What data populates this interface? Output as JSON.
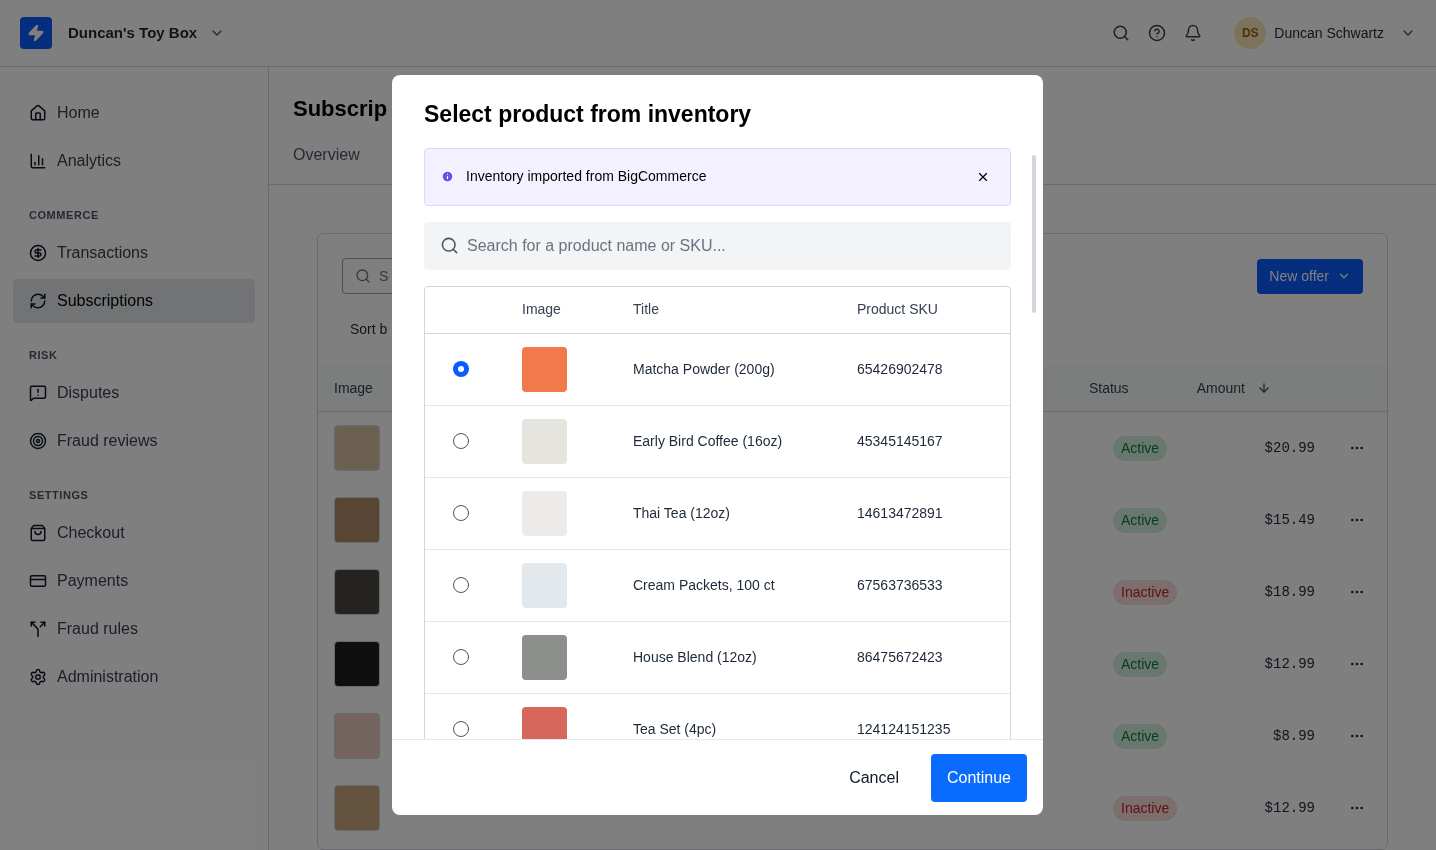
{
  "header": {
    "store_name": "Duncan's Toy Box",
    "user_initials": "DS",
    "user_name": "Duncan Schwartz"
  },
  "sidebar": {
    "sections": [
      {
        "items": [
          {
            "label": "Home",
            "selected": false
          },
          {
            "label": "Analytics",
            "selected": false
          }
        ]
      },
      {
        "label": "COMMERCE",
        "items": [
          {
            "label": "Transactions",
            "selected": false
          },
          {
            "label": "Subscriptions",
            "selected": true
          }
        ]
      },
      {
        "label": "RISK",
        "items": [
          {
            "label": "Disputes",
            "selected": false
          },
          {
            "label": "Fraud reviews",
            "selected": false
          }
        ]
      },
      {
        "label": "SETTINGS",
        "items": [
          {
            "label": "Checkout",
            "selected": false
          },
          {
            "label": "Payments",
            "selected": false
          },
          {
            "label": "Fraud rules",
            "selected": false
          },
          {
            "label": "Administration",
            "selected": false
          }
        ]
      }
    ]
  },
  "page": {
    "title": "Subscrip",
    "tab": "Overview",
    "search_placeholder": "S",
    "sort_label": "Sort b",
    "new_offer_button": "New offer",
    "columns": [
      "Image",
      "Status",
      "Amount"
    ],
    "rows": [
      {
        "status": "Active",
        "kind": "active",
        "amount": "$20.99"
      },
      {
        "status": "Active",
        "kind": "active",
        "amount": "$15.49"
      },
      {
        "status": "Inactive",
        "kind": "inactive",
        "amount": "$18.99"
      },
      {
        "status": "Active",
        "kind": "active",
        "amount": "$12.99"
      },
      {
        "status": "Active",
        "kind": "active",
        "amount": "$8.99"
      },
      {
        "status": "Inactive",
        "kind": "inactive",
        "amount": "$12.99"
      }
    ]
  },
  "modal": {
    "title": "Select product from inventory",
    "notice": "Inventory imported from BigCommerce",
    "search_placeholder": "Search for a product name or SKU...",
    "columns": [
      "Image",
      "Title",
      "Product SKU"
    ],
    "products": [
      {
        "selected": true,
        "title": "Matcha Powder (200g)",
        "sku": "65426902478"
      },
      {
        "selected": false,
        "title": "Early Bird Coffee (16oz)",
        "sku": "45345145167"
      },
      {
        "selected": false,
        "title": "Thai Tea (12oz)",
        "sku": "14613472891"
      },
      {
        "selected": false,
        "title": "Cream Packets, 100 ct",
        "sku": "67563736533"
      },
      {
        "selected": false,
        "title": "House Blend (12oz)",
        "sku": "86475672423"
      },
      {
        "selected": false,
        "title": "Tea Set (4pc)",
        "sku": "124124151235"
      }
    ],
    "cancel_button": "Cancel",
    "continue_button": "Continue"
  }
}
